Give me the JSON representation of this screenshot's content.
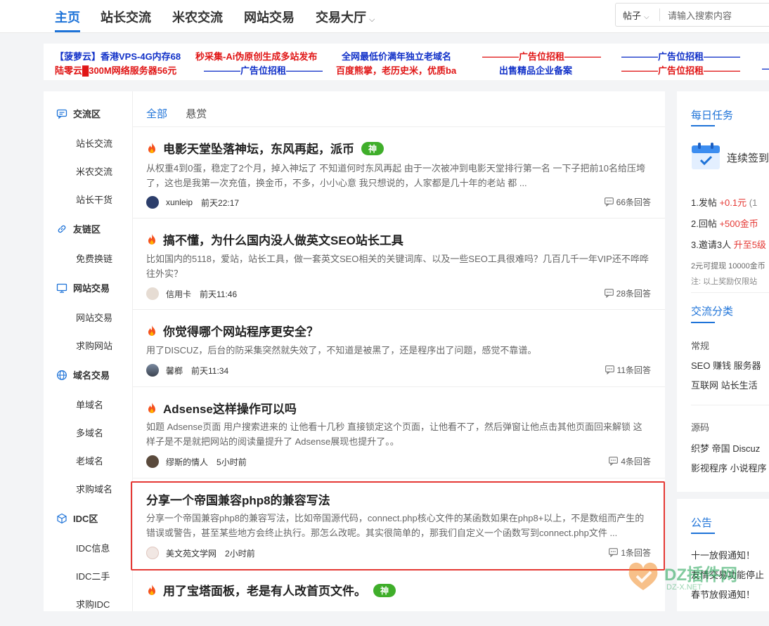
{
  "nav": {
    "items": [
      "主页",
      "站长交流",
      "米农交流",
      "网站交易",
      "交易大厅"
    ],
    "search_type": "帖子",
    "search_placeholder": "请输入搜索内容"
  },
  "ads": [
    {
      "text": "【菠萝云】香港VPS-4G内存68",
      "color": "#1030c8"
    },
    {
      "text": "秒采集-Ai伪原创生成多站发布",
      "color": "#e01515"
    },
    {
      "text": "全网最低价满年独立老域名",
      "color": "#1030c8"
    },
    {
      "text": "————广告位招租————",
      "color": "#e01515"
    },
    {
      "text": "————广告位招租————",
      "color": "#1030c8"
    },
    {
      "text": "陆零云█300M网络服务器56元",
      "color": "#e01515"
    },
    {
      "text": "————广告位招租————",
      "color": "#1030c8"
    },
    {
      "text": "百度熊掌，老历史米，优质ba",
      "color": "#e01515"
    },
    {
      "text": "出售精品企业备案",
      "color": "#1030c8"
    },
    {
      "text": "————广告位招租————",
      "color": "#e01515"
    },
    {
      "text": "—",
      "color": "#1030c8"
    }
  ],
  "sidebar": {
    "sections": [
      {
        "label": "交流区",
        "icon": "chat-icon",
        "items": [
          "站长交流",
          "米农交流",
          "站长干货"
        ]
      },
      {
        "label": "友链区",
        "icon": "link-icon",
        "items": [
          "免费换链"
        ]
      },
      {
        "label": "网站交易",
        "icon": "monitor-icon",
        "items": [
          "网站交易",
          "求购网站"
        ]
      },
      {
        "label": "域名交易",
        "icon": "globe-icon",
        "items": [
          "单域名",
          "多域名",
          "老域名",
          "求购域名"
        ]
      },
      {
        "label": "IDC区",
        "icon": "cube-icon",
        "items": [
          "IDC信息",
          "IDC二手",
          "求购IDC"
        ]
      }
    ]
  },
  "tabs": [
    "全部",
    "悬赏"
  ],
  "posts": [
    {
      "title": "电影天堂坠落神坛，东风再起，派币",
      "hot": true,
      "badge": "神",
      "excerpt": "从权重4到0蛋，稳定了2个月，掉入神坛了 不知道何时东风再起 由于一次被冲到电影天堂排行第一名 一下子把前10名给压垮了，这也是我第一次充值，换金币，不多，小小心意 我只想说的，人家都是几十年的老站 都 ...",
      "author": "xunleip",
      "time": "前天22:17",
      "replies": "66条回答"
    },
    {
      "title": "搞不懂，为什么国内没人做英文SEO站长工具",
      "hot": true,
      "badge": "",
      "excerpt": "比如国内的5118，爱站，站长工具，做一套英文SEO相关的关键词库、以及一些SEO工具很难吗？几百几千一年VIP还不哗哗往外实？",
      "author": "信用卡",
      "time": "前天11:46",
      "replies": "28条回答"
    },
    {
      "title": "你觉得哪个网站程序更安全？",
      "hot": true,
      "badge": "",
      "excerpt": "用了DISCUZ，后台的防采集突然就失效了，不知道是被黑了，还是程序出了问题，感觉不靠谱。",
      "author": "馨榔",
      "time": "前天11:34",
      "replies": "11条回答"
    },
    {
      "title": "Adsense这样操作可以吗",
      "hot": true,
      "badge": "",
      "excerpt": "如题 Adsense页面 用户搜索进来的 让他看十几秒 直接锁定这个页面，让他看不了，然后弹窗让他点击其他页面回来解锁 这样子是不是就把网站的阅读量提升了 Adsense展现也提升了。。",
      "author": "缪斯的情人",
      "time": "5小时前",
      "replies": "4条回答"
    },
    {
      "title": "分享一个帝国兼容php8的兼容写法",
      "hot": false,
      "badge": "",
      "excerpt": "分享一个帝国兼容php8的兼容写法，比如帝国源代码，connect.php核心文件的某函数如果在php8+以上，不是数组而产生的错误或警告，甚至某些地方会终止执行。那怎么改呢。其实很简单的，那我们自定义一个函数写到connect.php文件 ...",
      "author": "美文苑文学网",
      "time": "2小时前",
      "replies": "1条回答"
    },
    {
      "title": "用了宝塔面板，老是有人改首页文件。",
      "hot": true,
      "badge": "神",
      "excerpt": "",
      "author": "",
      "time": "",
      "replies": ""
    }
  ],
  "right": {
    "daily_title": "每日任务",
    "checkin": "连续签到",
    "task1_label": "1.发帖",
    "task1_reward": "+0.1元",
    "task1_extra": "(1",
    "task2_label": "2.回帖",
    "task2_reward": "+500金币",
    "task3_label": "3.邀请3人",
    "task3_reward": "升至5级",
    "note1": "2元可提现 10000金币",
    "note2": "注:   以上奖励仅限站",
    "cat_title": "交流分类",
    "cat1_name": "常规",
    "cat1_row1": "SEO   赚钱   服务器",
    "cat1_row2": "互联网   站长生活",
    "cat2_name": "源码",
    "cat2_row1": "织梦   帝国   Discuz",
    "cat2_row2": "影视程序   小说程序",
    "notice_title": "公告",
    "notice1": "十一放假通知！",
    "notice2": "友情交易功能停止",
    "notice3": "春节放假通知！"
  },
  "watermark": {
    "text": "DZ插件网",
    "sub": "DZ-X.NET"
  }
}
